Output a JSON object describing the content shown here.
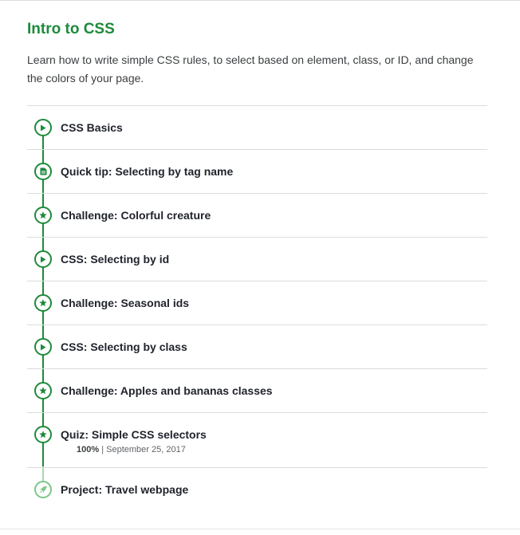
{
  "section": {
    "title": "Intro to CSS",
    "description": "Learn how to write simple CSS rules, to select based on element, class, or ID, and change the colors of your page."
  },
  "items": [
    {
      "label": "CSS Basics",
      "icon": "play-icon"
    },
    {
      "label": "Quick tip: Selecting by tag name",
      "icon": "article-icon"
    },
    {
      "label": "Challenge: Colorful creature",
      "icon": "star-icon"
    },
    {
      "label": "CSS: Selecting by id",
      "icon": "play-icon"
    },
    {
      "label": "Challenge: Seasonal ids",
      "icon": "star-icon"
    },
    {
      "label": "CSS: Selecting by class",
      "icon": "play-icon"
    },
    {
      "label": "Challenge: Apples and bananas classes",
      "icon": "star-icon"
    },
    {
      "label": "Quiz: Simple CSS selectors",
      "icon": "star-icon",
      "score": "100%",
      "separator": "|",
      "date": "September 25, 2017"
    },
    {
      "label": "Project: Travel webpage",
      "icon": "rocket-icon"
    }
  ],
  "colors": {
    "accent": "#1e8a3c",
    "accent_light": "#7cc68a",
    "divider": "#dadbdd"
  }
}
